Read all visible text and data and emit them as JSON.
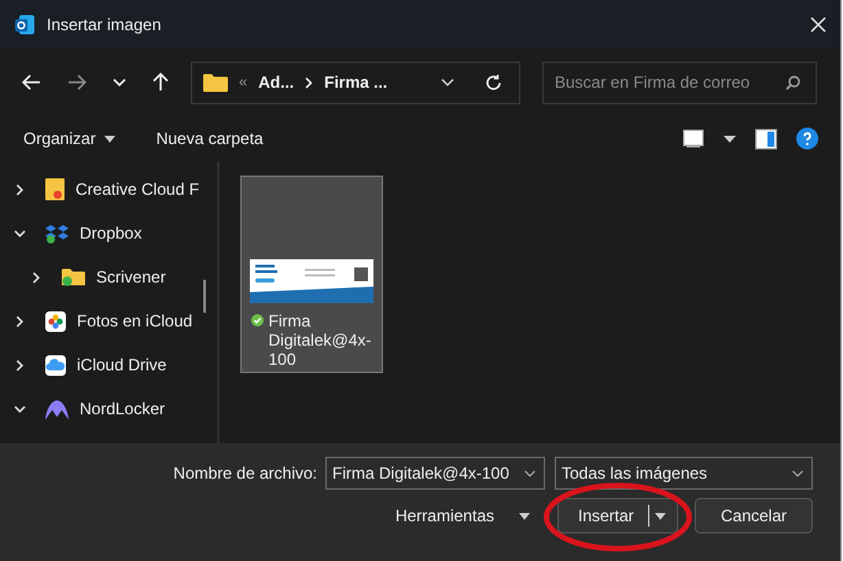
{
  "window": {
    "title": "Insertar imagen"
  },
  "address": {
    "overflow": "«",
    "crumbs": [
      "Ad...",
      "Firma ..."
    ]
  },
  "search": {
    "placeholder": "Buscar en Firma de correo"
  },
  "toolbar": {
    "organize": "Organizar",
    "new_folder": "Nueva carpeta"
  },
  "sidebar": {
    "items": [
      {
        "label": "Creative Cloud F",
        "kind": "creative-cloud",
        "expanded": false
      },
      {
        "label": "Dropbox",
        "kind": "dropbox",
        "expanded": true,
        "children": [
          {
            "label": "Scrivener",
            "kind": "synced-folder",
            "expanded": false
          }
        ]
      },
      {
        "label": "Fotos en iCloud",
        "kind": "photos",
        "expanded": false
      },
      {
        "label": "iCloud Drive",
        "kind": "cloud",
        "expanded": false
      },
      {
        "label": "NordLocker",
        "kind": "nordlocker",
        "expanded": true
      }
    ]
  },
  "files": [
    {
      "name": "Firma Digitalek@4x-100",
      "selected": true,
      "synced": true
    }
  ],
  "footer": {
    "filename_label": "Nombre de archivo:",
    "filename": "Firma Digitalek@4x-100",
    "filter": "Todas las imágenes",
    "tools": "Herramientas",
    "insert": "Insertar",
    "cancel": "Cancelar"
  },
  "annotation": {
    "circled": true
  }
}
